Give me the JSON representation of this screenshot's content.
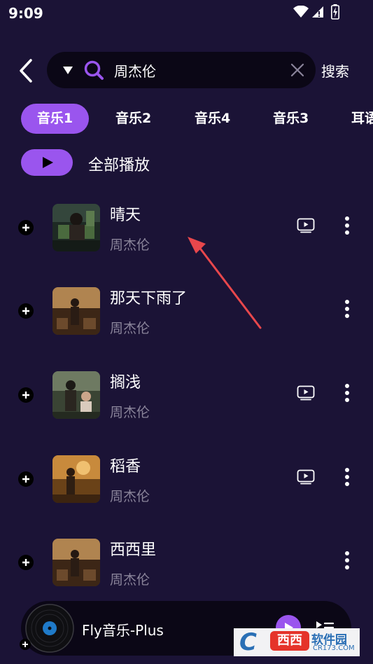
{
  "status_bar": {
    "time": "9:09",
    "icons": [
      "wifi-icon",
      "signal-icon",
      "battery-charging-icon"
    ]
  },
  "header": {
    "back_icon": "back-arrow-icon",
    "search_value": "周杰伦",
    "search_submit_label": "搜索"
  },
  "tabs": [
    {
      "label": "音乐1",
      "active": true
    },
    {
      "label": "音乐2",
      "active": false
    },
    {
      "label": "音乐4",
      "active": false
    },
    {
      "label": "音乐3",
      "active": false
    },
    {
      "label": "耳语",
      "active": false
    }
  ],
  "play_all": {
    "label": "全部播放"
  },
  "songs": [
    {
      "title": "晴天",
      "artist": "周杰伦",
      "has_mv": true
    },
    {
      "title": "那天下雨了",
      "artist": "周杰伦",
      "has_mv": false
    },
    {
      "title": "搁浅",
      "artist": "周杰伦",
      "has_mv": true
    },
    {
      "title": "稻香",
      "artist": "周杰伦",
      "has_mv": true
    },
    {
      "title": "西西里",
      "artist": "周杰伦",
      "has_mv": false
    }
  ],
  "mini_player": {
    "title": "Fly音乐-Plus"
  },
  "colors": {
    "background": "#1b1336",
    "accent": "#9a55ee",
    "secondary_text": "#8a849a",
    "annotation_arrow": "#e8474c"
  },
  "watermark": {
    "brand_letter": "C",
    "brand_badge": "西西",
    "brand_name": "软件园",
    "domain": "CR173.COM"
  }
}
